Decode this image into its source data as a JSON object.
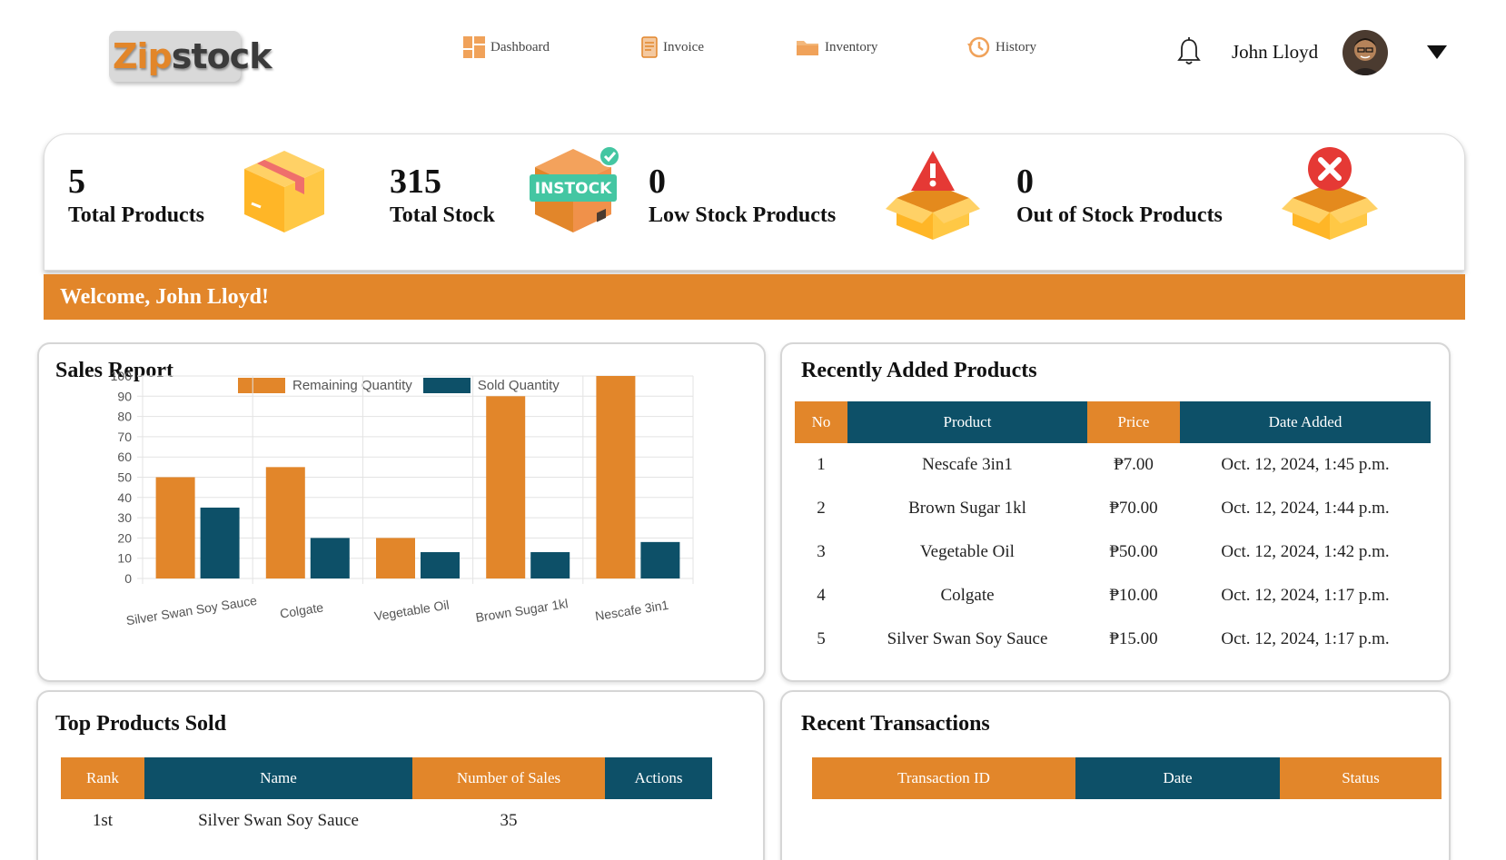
{
  "app": {
    "logo_part1": "Zip",
    "logo_part2": "stock"
  },
  "nav": [
    {
      "label": "Dashboard",
      "icon": "dashboard-icon"
    },
    {
      "label": "Invoice",
      "icon": "invoice-icon"
    },
    {
      "label": "Inventory",
      "icon": "folder-icon"
    },
    {
      "label": "History",
      "icon": "history-icon"
    }
  ],
  "user": {
    "name": "John Lloyd",
    "notification_icon": "bell-icon",
    "menu_icon": "caret-down-icon"
  },
  "stats": [
    {
      "value": "5",
      "label": "Total Products",
      "icon": "box-icon"
    },
    {
      "value": "315",
      "label": "Total Stock",
      "icon": "in-stock-icon",
      "badge": "INSTOCK"
    },
    {
      "value": "0",
      "label": "Low Stock Products",
      "icon": "warning-box-icon"
    },
    {
      "value": "0",
      "label": "Out of Stock Products",
      "icon": "out-of-stock-box-icon"
    }
  ],
  "welcome": "Welcome, John Lloyd!",
  "sales_report": {
    "title": "Sales Report"
  },
  "chart_data": {
    "type": "bar",
    "categories": [
      "Silver Swan Soy Sauce",
      "Colgate",
      "Vegetable Oil",
      "Brown Sugar 1kl",
      "Nescafe 3in1"
    ],
    "series": [
      {
        "name": "Remaining Quantity",
        "color": "#e2862a",
        "values": [
          50,
          55,
          20,
          90,
          100
        ]
      },
      {
        "name": "Sold Quantity",
        "color": "#0d5068",
        "values": [
          35,
          20,
          13,
          13,
          18
        ]
      }
    ],
    "ylim": [
      0,
      100
    ],
    "yticks": [
      0,
      10,
      20,
      30,
      40,
      50,
      60,
      70,
      80,
      90,
      100
    ],
    "grid": true,
    "legend": "top"
  },
  "recent_products": {
    "title": "Recently Added Products",
    "columns": [
      "No",
      "Product",
      "Price",
      "Date Added"
    ],
    "rows": [
      [
        "1",
        "Nescafe 3in1",
        "₱7.00",
        "Oct. 12, 2024, 1:45 p.m."
      ],
      [
        "2",
        "Brown Sugar 1kl",
        "₱70.00",
        "Oct. 12, 2024, 1:44 p.m."
      ],
      [
        "3",
        "Vegetable Oil",
        "₱50.00",
        "Oct. 12, 2024, 1:42 p.m."
      ],
      [
        "4",
        "Colgate",
        "₱10.00",
        "Oct. 12, 2024, 1:17 p.m."
      ],
      [
        "5",
        "Silver Swan Soy Sauce",
        "₱15.00",
        "Oct. 12, 2024, 1:17 p.m."
      ]
    ]
  },
  "top_products": {
    "title": "Top Products Sold",
    "columns": [
      "Rank",
      "Name",
      "Number of Sales",
      "Actions"
    ],
    "rows": [
      [
        "1st",
        "Silver Swan Soy Sauce",
        "35",
        ""
      ]
    ]
  },
  "recent_transactions": {
    "title": "Recent Transactions",
    "columns": [
      "Transaction ID",
      "Date",
      "Status"
    ]
  },
  "colors": {
    "accent": "#e2862a",
    "secondary": "#0d5068"
  }
}
